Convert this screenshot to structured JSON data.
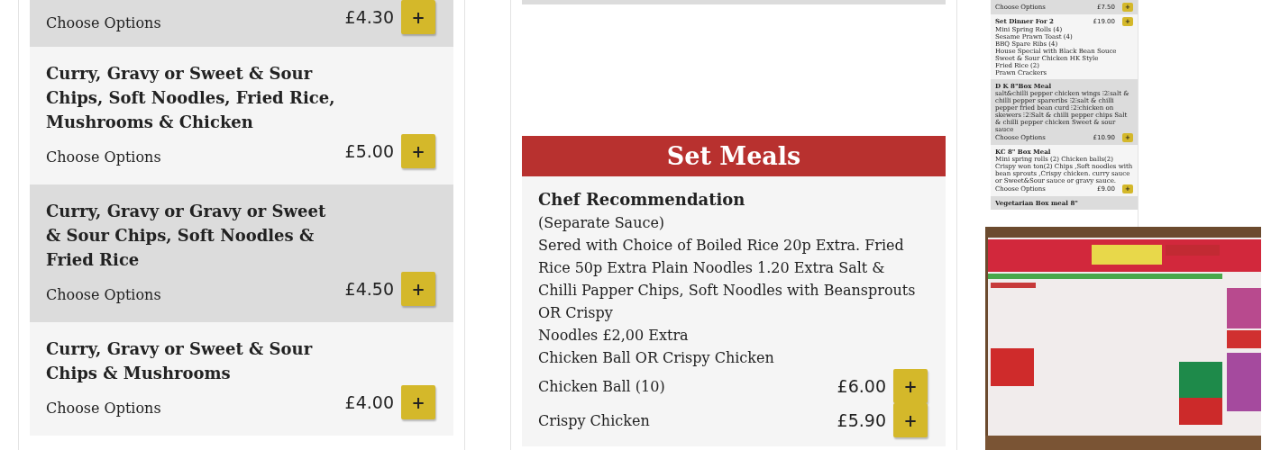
{
  "left_panel": {
    "items": [
      {
        "options_label": "Choose Options",
        "price": "£4.30",
        "button": "+"
      },
      {
        "name": "Curry, Gravy or Sweet & Sour Chips, Soft Noodles, Fried Rice, Mushrooms & Chicken",
        "options_label": "Choose Options",
        "price": "£5.00",
        "button": "+"
      },
      {
        "name": "Curry, Gravy or Gravy or Sweet & Sour Chips, Soft Noodles & Fried Rice",
        "options_label": "Choose Options",
        "price": "£4.50",
        "button": "+"
      },
      {
        "name": "Curry, Gravy or Sweet & Sour Chips & Mushrooms",
        "options_label": "Choose Options",
        "price": "£4.00",
        "button": "+"
      }
    ]
  },
  "middle_panel": {
    "section_title": "Set Meals",
    "item": {
      "name": "Chef Recommendation",
      "description": [
        "(Separate Sauce)",
        "Sered with Choice of Boiled Rice 20p Extra. Fried Rice 50p Extra Plain Noodles 1.20 Extra Salt & Chilli Papper Chips, Soft Noodles with Beansprouts OR Crispy",
        "Noodles £2,00 Extra",
        "Chicken Ball OR Crispy Chicken"
      ],
      "variants": [
        {
          "label": "Chicken Ball (10)",
          "price": "£6.00",
          "button": "+"
        },
        {
          "label": "Crispy Chicken",
          "price": "£5.90",
          "button": "+"
        }
      ]
    }
  },
  "right_panel": {
    "items": [
      {
        "options_label": "Choose Options",
        "price": "£7.50",
        "button": "+"
      },
      {
        "name": "Set Dinner For 2",
        "name_price": "£19.00",
        "button": "+",
        "description": [
          "Mini Spring Rolls (4)",
          "Sesame Prawn Toast (4)",
          "BBQ Spare Ribs (4)",
          "House Special with Black Bean Souce",
          "Sweet & Sour Chicken HK Style",
          "Fried Rice (2)",
          "Prawn Crackers"
        ]
      },
      {
        "name": "D K 8\"Box Meal",
        "description": [
          "salt&chilli pepper chicken wings ⁝2⁝salt & chilli pepper spareribs ⁝2⁝salt & chilli pepper fried bean curd ⁝2⁝chicken on skewers ⁝2⁝Salt & chilli pepper chips Salt & chilli pepper chicken Sweet & sour sauce"
        ],
        "options_label": "Choose Options",
        "price": "£10.90",
        "button": "+"
      },
      {
        "name": "KC 8\" Box Meal",
        "description": [
          "Mini spring rolls (2) Chicken balls(2) Crispy won ton(2) Chips ,Soft noodles with bean sprouts ,Crispy chicken. curry sauce or Sweet&Sour sauce or gravy sauce."
        ],
        "options_label": "Choose Options",
        "price": "£9.00",
        "button": "+"
      },
      {
        "name": "Vegetarian Box meal 8\""
      }
    ]
  }
}
